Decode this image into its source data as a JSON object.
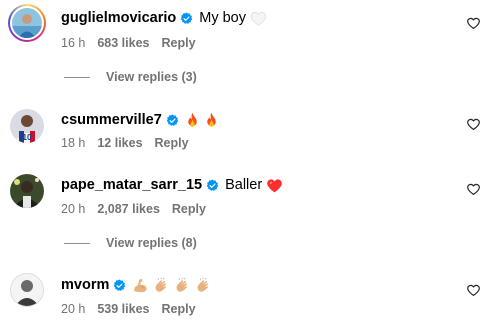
{
  "comments": [
    {
      "username": "guglielmovicario",
      "text": "My boy",
      "emoji": "white-heart",
      "time": "16 h",
      "likes": "683 likes",
      "reply": "Reply",
      "view_replies": "View replies (3)"
    },
    {
      "username": "csummerville7",
      "text": "",
      "emoji": "fire fire",
      "time": "18 h",
      "likes": "12 likes",
      "reply": "Reply"
    },
    {
      "username": "pape_matar_sarr_15",
      "text": "Baller",
      "emoji": "red-heart",
      "time": "20 h",
      "likes": "2,087 likes",
      "reply": "Reply",
      "view_replies": "View replies (8)"
    },
    {
      "username": "mvorm",
      "text": "",
      "emoji": "flexed-biceps clapping-hands clapping-hands clapping-hands",
      "time": "20 h",
      "likes": "539 likes",
      "reply": "Reply"
    }
  ],
  "colors": {
    "verified_blue": "#0095f6",
    "meta_gray": "#737373",
    "heart_red": "#ff2d2d"
  }
}
